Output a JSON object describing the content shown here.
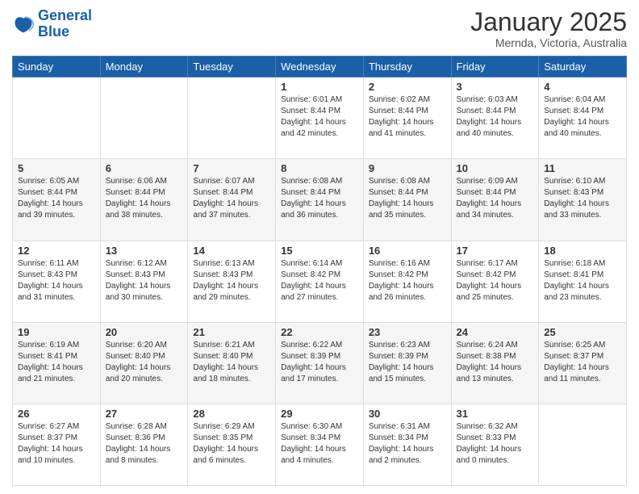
{
  "header": {
    "logo_text_general": "General",
    "logo_text_blue": "Blue",
    "month_title": "January 2025",
    "location": "Mernda, Victoria, Australia"
  },
  "days_of_week": [
    "Sunday",
    "Monday",
    "Tuesday",
    "Wednesday",
    "Thursday",
    "Friday",
    "Saturday"
  ],
  "weeks": [
    [
      {
        "day": null,
        "info": ""
      },
      {
        "day": null,
        "info": ""
      },
      {
        "day": null,
        "info": ""
      },
      {
        "day": "1",
        "info": "Sunrise: 6:01 AM\nSunset: 8:44 PM\nDaylight: 14 hours\nand 42 minutes."
      },
      {
        "day": "2",
        "info": "Sunrise: 6:02 AM\nSunset: 8:44 PM\nDaylight: 14 hours\nand 41 minutes."
      },
      {
        "day": "3",
        "info": "Sunrise: 6:03 AM\nSunset: 8:44 PM\nDaylight: 14 hours\nand 40 minutes."
      },
      {
        "day": "4",
        "info": "Sunrise: 6:04 AM\nSunset: 8:44 PM\nDaylight: 14 hours\nand 40 minutes."
      }
    ],
    [
      {
        "day": "5",
        "info": "Sunrise: 6:05 AM\nSunset: 8:44 PM\nDaylight: 14 hours\nand 39 minutes."
      },
      {
        "day": "6",
        "info": "Sunrise: 6:06 AM\nSunset: 8:44 PM\nDaylight: 14 hours\nand 38 minutes."
      },
      {
        "day": "7",
        "info": "Sunrise: 6:07 AM\nSunset: 8:44 PM\nDaylight: 14 hours\nand 37 minutes."
      },
      {
        "day": "8",
        "info": "Sunrise: 6:08 AM\nSunset: 8:44 PM\nDaylight: 14 hours\nand 36 minutes."
      },
      {
        "day": "9",
        "info": "Sunrise: 6:08 AM\nSunset: 8:44 PM\nDaylight: 14 hours\nand 35 minutes."
      },
      {
        "day": "10",
        "info": "Sunrise: 6:09 AM\nSunset: 8:44 PM\nDaylight: 14 hours\nand 34 minutes."
      },
      {
        "day": "11",
        "info": "Sunrise: 6:10 AM\nSunset: 8:43 PM\nDaylight: 14 hours\nand 33 minutes."
      }
    ],
    [
      {
        "day": "12",
        "info": "Sunrise: 6:11 AM\nSunset: 8:43 PM\nDaylight: 14 hours\nand 31 minutes."
      },
      {
        "day": "13",
        "info": "Sunrise: 6:12 AM\nSunset: 8:43 PM\nDaylight: 14 hours\nand 30 minutes."
      },
      {
        "day": "14",
        "info": "Sunrise: 6:13 AM\nSunset: 8:43 PM\nDaylight: 14 hours\nand 29 minutes."
      },
      {
        "day": "15",
        "info": "Sunrise: 6:14 AM\nSunset: 8:42 PM\nDaylight: 14 hours\nand 27 minutes."
      },
      {
        "day": "16",
        "info": "Sunrise: 6:16 AM\nSunset: 8:42 PM\nDaylight: 14 hours\nand 26 minutes."
      },
      {
        "day": "17",
        "info": "Sunrise: 6:17 AM\nSunset: 8:42 PM\nDaylight: 14 hours\nand 25 minutes."
      },
      {
        "day": "18",
        "info": "Sunrise: 6:18 AM\nSunset: 8:41 PM\nDaylight: 14 hours\nand 23 minutes."
      }
    ],
    [
      {
        "day": "19",
        "info": "Sunrise: 6:19 AM\nSunset: 8:41 PM\nDaylight: 14 hours\nand 21 minutes."
      },
      {
        "day": "20",
        "info": "Sunrise: 6:20 AM\nSunset: 8:40 PM\nDaylight: 14 hours\nand 20 minutes."
      },
      {
        "day": "21",
        "info": "Sunrise: 6:21 AM\nSunset: 8:40 PM\nDaylight: 14 hours\nand 18 minutes."
      },
      {
        "day": "22",
        "info": "Sunrise: 6:22 AM\nSunset: 8:39 PM\nDaylight: 14 hours\nand 17 minutes."
      },
      {
        "day": "23",
        "info": "Sunrise: 6:23 AM\nSunset: 8:39 PM\nDaylight: 14 hours\nand 15 minutes."
      },
      {
        "day": "24",
        "info": "Sunrise: 6:24 AM\nSunset: 8:38 PM\nDaylight: 14 hours\nand 13 minutes."
      },
      {
        "day": "25",
        "info": "Sunrise: 6:25 AM\nSunset: 8:37 PM\nDaylight: 14 hours\nand 11 minutes."
      }
    ],
    [
      {
        "day": "26",
        "info": "Sunrise: 6:27 AM\nSunset: 8:37 PM\nDaylight: 14 hours\nand 10 minutes."
      },
      {
        "day": "27",
        "info": "Sunrise: 6:28 AM\nSunset: 8:36 PM\nDaylight: 14 hours\nand 8 minutes."
      },
      {
        "day": "28",
        "info": "Sunrise: 6:29 AM\nSunset: 8:35 PM\nDaylight: 14 hours\nand 6 minutes."
      },
      {
        "day": "29",
        "info": "Sunrise: 6:30 AM\nSunset: 8:34 PM\nDaylight: 14 hours\nand 4 minutes."
      },
      {
        "day": "30",
        "info": "Sunrise: 6:31 AM\nSunset: 8:34 PM\nDaylight: 14 hours\nand 2 minutes."
      },
      {
        "day": "31",
        "info": "Sunrise: 6:32 AM\nSunset: 8:33 PM\nDaylight: 14 hours\nand 0 minutes."
      },
      {
        "day": null,
        "info": ""
      }
    ]
  ]
}
